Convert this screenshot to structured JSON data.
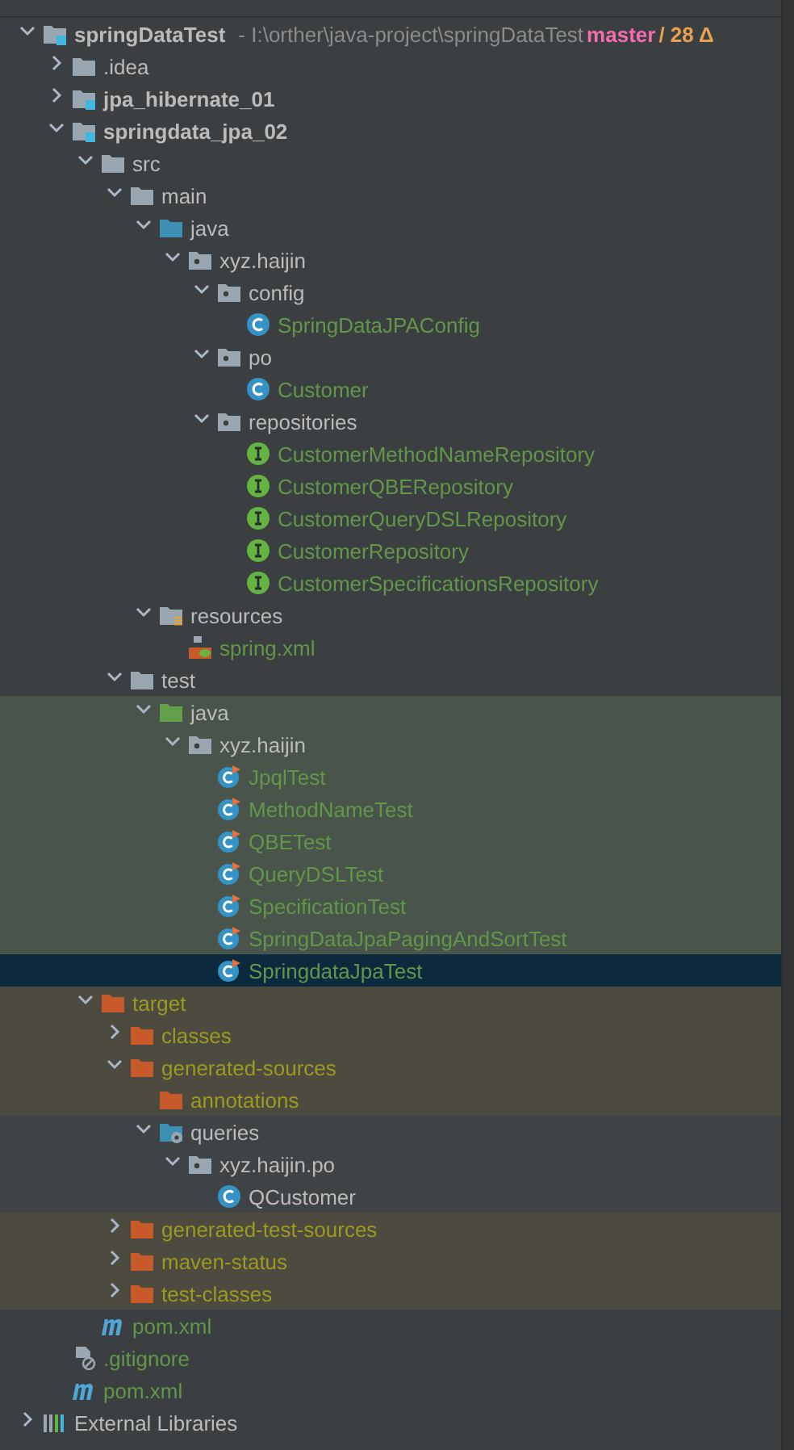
{
  "tree": [
    {
      "name": "springDataTest",
      "kind": "module",
      "expanded": true,
      "selected": false,
      "path": "- I:\\orther\\java-project\\springDataTest",
      "branch": "master",
      "changes": "/ 28 Δ",
      "children": [
        {
          "name": ".idea",
          "kind": "folder",
          "expanded": false,
          "selected": false
        },
        {
          "name": "jpa_hibernate_01",
          "kind": "module",
          "expanded": false,
          "selected": false
        },
        {
          "name": "springdata_jpa_02",
          "kind": "module",
          "expanded": true,
          "selected": false,
          "children": [
            {
              "name": "src",
              "kind": "folder",
              "expanded": true,
              "selected": false,
              "children": [
                {
                  "name": "main",
                  "kind": "folder",
                  "expanded": true,
                  "selected": false,
                  "children": [
                    {
                      "name": "java",
                      "kind": "source-folder",
                      "expanded": true,
                      "selected": false,
                      "children": [
                        {
                          "name": "xyz.haijin",
                          "kind": "package",
                          "expanded": true,
                          "selected": false,
                          "children": [
                            {
                              "name": "config",
                              "kind": "package",
                              "expanded": true,
                              "selected": false,
                              "children": [
                                {
                                  "name": "SpringDataJPAConfig",
                                  "kind": "class",
                                  "added": true,
                                  "selected": false
                                }
                              ]
                            },
                            {
                              "name": "po",
                              "kind": "package",
                              "expanded": true,
                              "selected": false,
                              "children": [
                                {
                                  "name": "Customer",
                                  "kind": "class",
                                  "added": true,
                                  "selected": false
                                }
                              ]
                            },
                            {
                              "name": "repositories",
                              "kind": "package",
                              "expanded": true,
                              "selected": false,
                              "children": [
                                {
                                  "name": "CustomerMethodNameRepository",
                                  "kind": "interface",
                                  "added": true,
                                  "selected": false
                                },
                                {
                                  "name": "CustomerQBERepository",
                                  "kind": "interface",
                                  "added": true,
                                  "selected": false
                                },
                                {
                                  "name": "CustomerQueryDSLRepository",
                                  "kind": "interface",
                                  "added": true,
                                  "selected": false
                                },
                                {
                                  "name": "CustomerRepository",
                                  "kind": "interface",
                                  "added": true,
                                  "selected": false
                                },
                                {
                                  "name": "CustomerSpecificationsRepository",
                                  "kind": "interface",
                                  "added": true,
                                  "selected": false
                                }
                              ]
                            }
                          ]
                        }
                      ]
                    },
                    {
                      "name": "resources",
                      "kind": "resources-folder",
                      "expanded": true,
                      "selected": false,
                      "children": [
                        {
                          "name": "spring.xml",
                          "kind": "spring-xml",
                          "added": true,
                          "selected": false
                        }
                      ]
                    }
                  ]
                },
                {
                  "name": "test",
                  "kind": "folder",
                  "expanded": true,
                  "selected": false,
                  "children": [
                    {
                      "name": "java",
                      "kind": "test-folder",
                      "expanded": true,
                      "selected": false,
                      "test_root": true,
                      "children": [
                        {
                          "name": "xyz.haijin",
                          "kind": "package",
                          "expanded": true,
                          "selected": false,
                          "test_root": true,
                          "children": [
                            {
                              "name": "JpqlTest",
                              "kind": "test-class",
                              "added": true,
                              "selected": false,
                              "test_root": true
                            },
                            {
                              "name": "MethodNameTest",
                              "kind": "test-class",
                              "added": true,
                              "selected": false,
                              "test_root": true
                            },
                            {
                              "name": "QBETest",
                              "kind": "test-class",
                              "added": true,
                              "selected": false,
                              "test_root": true
                            },
                            {
                              "name": "QueryDSLTest",
                              "kind": "test-class",
                              "added": true,
                              "selected": false,
                              "test_root": true
                            },
                            {
                              "name": "SpecificationTest",
                              "kind": "test-class",
                              "added": true,
                              "selected": false,
                              "test_root": true
                            },
                            {
                              "name": "SpringDataJpaPagingAndSortTest",
                              "kind": "test-class",
                              "added": true,
                              "selected": false,
                              "test_root": true
                            },
                            {
                              "name": "SpringdataJpaTest",
                              "kind": "test-class",
                              "added": true,
                              "selected": true,
                              "test_root": true
                            }
                          ]
                        }
                      ]
                    }
                  ]
                }
              ]
            },
            {
              "name": "target",
              "kind": "excluded-folder",
              "expanded": true,
              "selected": false,
              "ignored": true,
              "children": [
                {
                  "name": "classes",
                  "kind": "excluded-folder",
                  "expanded": false,
                  "selected": false,
                  "ignored": true
                },
                {
                  "name": "generated-sources",
                  "kind": "excluded-folder",
                  "expanded": true,
                  "selected": false,
                  "ignored": true,
                  "children": [
                    {
                      "name": "annotations",
                      "kind": "excluded-folder",
                      "selected": false,
                      "ignored": true
                    },
                    {
                      "name": "queries",
                      "kind": "generated-folder",
                      "expanded": true,
                      "selected": false,
                      "children": [
                        {
                          "name": "xyz.haijin.po",
                          "kind": "package",
                          "expanded": true,
                          "selected": false,
                          "children": [
                            {
                              "name": "QCustomer",
                              "kind": "class",
                              "selected": false
                            }
                          ]
                        }
                      ]
                    }
                  ]
                },
                {
                  "name": "generated-test-sources",
                  "kind": "excluded-folder",
                  "expanded": false,
                  "selected": false,
                  "ignored": true
                },
                {
                  "name": "maven-status",
                  "kind": "excluded-folder",
                  "expanded": false,
                  "selected": false,
                  "ignored": true
                },
                {
                  "name": "test-classes",
                  "kind": "excluded-folder",
                  "expanded": false,
                  "selected": false,
                  "ignored": true
                }
              ]
            },
            {
              "name": "pom.xml",
              "kind": "maven",
              "added": true,
              "selected": false
            }
          ]
        },
        {
          "name": ".gitignore",
          "kind": "gitignore",
          "added": true,
          "selected": false
        },
        {
          "name": "pom.xml",
          "kind": "maven",
          "added": true,
          "selected": false
        }
      ]
    },
    {
      "name": "External Libraries",
      "kind": "libraries",
      "expanded": false,
      "selected": false
    }
  ]
}
